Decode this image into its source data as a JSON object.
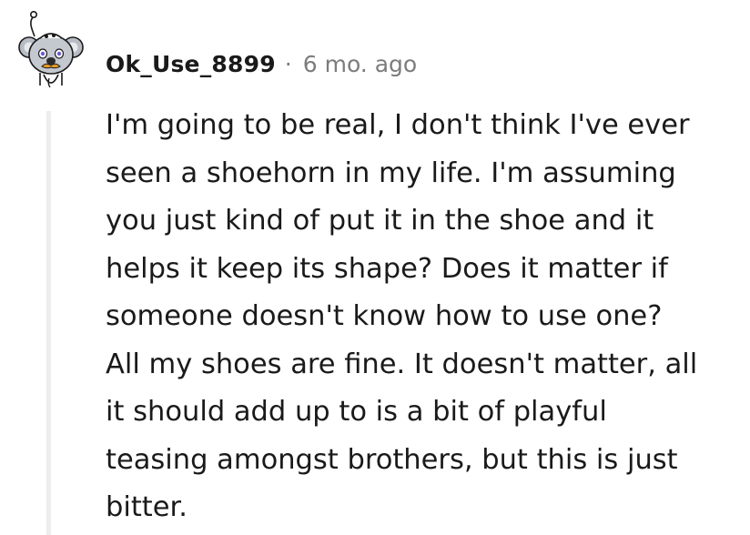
{
  "comment": {
    "author": "Ok_Use_8899",
    "separator": "·",
    "age": "6 mo. ago",
    "avatar_icon": "koala-avatar-icon",
    "body_lines": [
      "I'm going to be real, I don't think I've ever",
      "seen a shoehorn in my life. I'm assuming",
      "you just kind of put it in the shoe and it",
      "helps it keep its shape? Does it matter if",
      "someone doesn't know how to use one?",
      "All my shoes are fine. It doesn't matter, all",
      "it should add up to is a bit of playful",
      "teasing amongst brothers, but this is just",
      "bitter."
    ]
  },
  "colors": {
    "text": "#1a1a1b",
    "meta": "#7c7c7c",
    "thread_line": "#ededed"
  }
}
